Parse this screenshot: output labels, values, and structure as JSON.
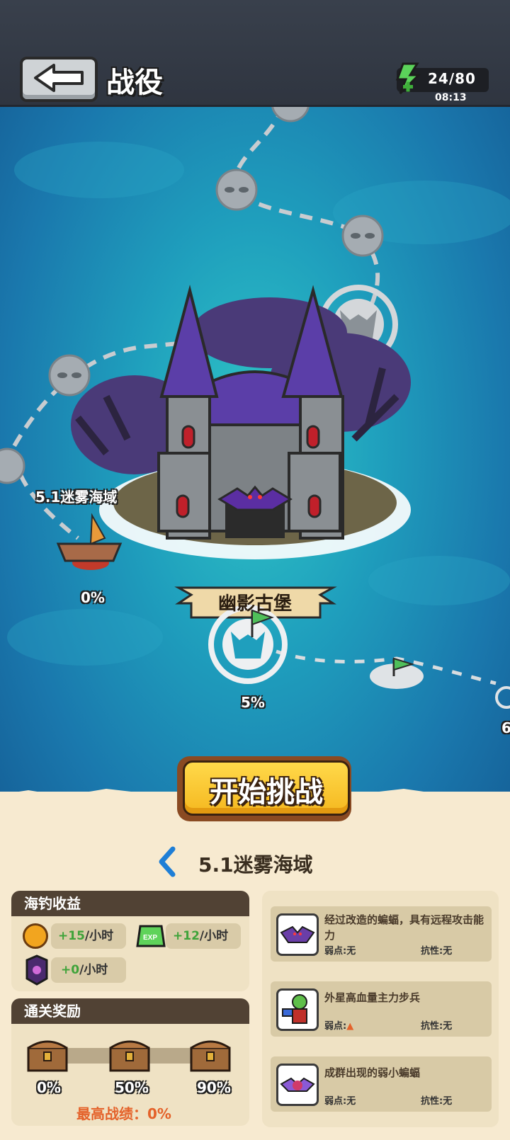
{
  "header": {
    "title": "战役",
    "energy": "24/80",
    "energy_timer": "08:13"
  },
  "map": {
    "current_node_label": "5.1迷雾海域",
    "node_percents": [
      "0%",
      "5%",
      "6"
    ],
    "castle_name": "幽影古堡"
  },
  "actions": {
    "start_label": "开始挑战"
  },
  "level": {
    "name": "5.1迷雾海域"
  },
  "fishing": {
    "title": "海钓收益",
    "gold_amount": "+15",
    "gold_unit": "/小时",
    "exp_amount": "+12",
    "exp_unit": "/小时",
    "gem_amount": "+0",
    "gem_unit": "/小时"
  },
  "clear_rewards": {
    "title": "通关奖励",
    "chests": [
      "0%",
      "50%",
      "90%"
    ],
    "best_label": "最高战绩：",
    "best_value": "0%"
  },
  "enemies": [
    {
      "description": "经过改造的蝙蝠，具有远程攻击能力",
      "weak": "弱点:无",
      "resist": "抗性:无",
      "icon": "bat-icon"
    },
    {
      "description": "外星高血量主力步兵",
      "weak": "弱点:",
      "resist": "抗性:无",
      "icon": "alien-soldier-icon"
    },
    {
      "description": "成群出现的弱小蝙蝠",
      "weak": "弱点:无",
      "resist": "抗性:无",
      "icon": "small-bat-icon"
    }
  ],
  "colors": {
    "sea": "#1f9fbd",
    "castle_roof": "#5b3ea8",
    "start_button": "#f5b820",
    "sand": "#f7ead0",
    "best_text": "#e4622a"
  }
}
